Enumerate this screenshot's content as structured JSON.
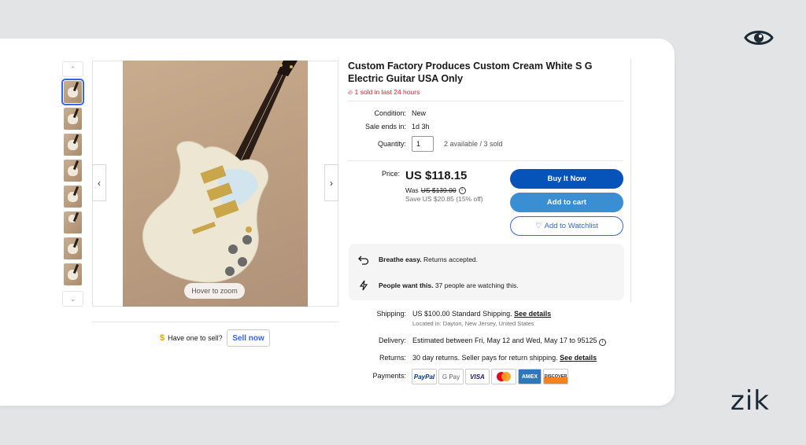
{
  "listing": {
    "title": "Custom Factory Produces Custom Cream White S G Electric Guitar USA Only",
    "sold_badge": "1 sold in last 24 hours",
    "condition_label": "Condition:",
    "condition_value": "New",
    "sale_ends_label": "Sale ends in:",
    "sale_ends_value": "1d 3h",
    "quantity_label": "Quantity:",
    "quantity_value": "1",
    "availability": "2 available / 3 sold"
  },
  "pricing": {
    "price_label": "Price:",
    "price": "US $118.15",
    "was_label": "Was",
    "was_price": "US $139.00",
    "save_text": "Save US $20.85 (15% off)"
  },
  "actions": {
    "buy_now": "Buy It Now",
    "add_to_cart": "Add to cart",
    "add_to_watchlist": "Add to Watchlist"
  },
  "highlights": {
    "returns_title": "Breathe easy.",
    "returns_text": "Returns accepted.",
    "watchers_title": "People want this.",
    "watchers_text": "37 people are watching this."
  },
  "shipping": {
    "shipping_label": "Shipping:",
    "shipping_value": "US $100.00 Standard Shipping.",
    "shipping_link": "See details",
    "location": "Located in: Dayton, New Jersey, United States",
    "delivery_label": "Delivery:",
    "delivery_value": "Estimated between Fri, May 12 and Wed, May 17 to 95125",
    "returns_label": "Returns:",
    "returns_value": "30 day returns. Seller pays for return shipping.",
    "returns_link": "See details",
    "payments_label": "Payments:"
  },
  "payments": [
    "PayPal",
    "G Pay",
    "VISA",
    "",
    "AMEX",
    "DISCOVER"
  ],
  "gallery": {
    "hover_zoom": "Hover to zoom",
    "have_one": "Have one to sell?",
    "sell_now": "Sell now"
  },
  "branding": {
    "watermark": "zik"
  },
  "colors": {
    "primary_blue": "#0654ba",
    "cart_blue": "#3a8fd2",
    "link_blue": "#3665f3",
    "alert_red": "#e0202e"
  }
}
